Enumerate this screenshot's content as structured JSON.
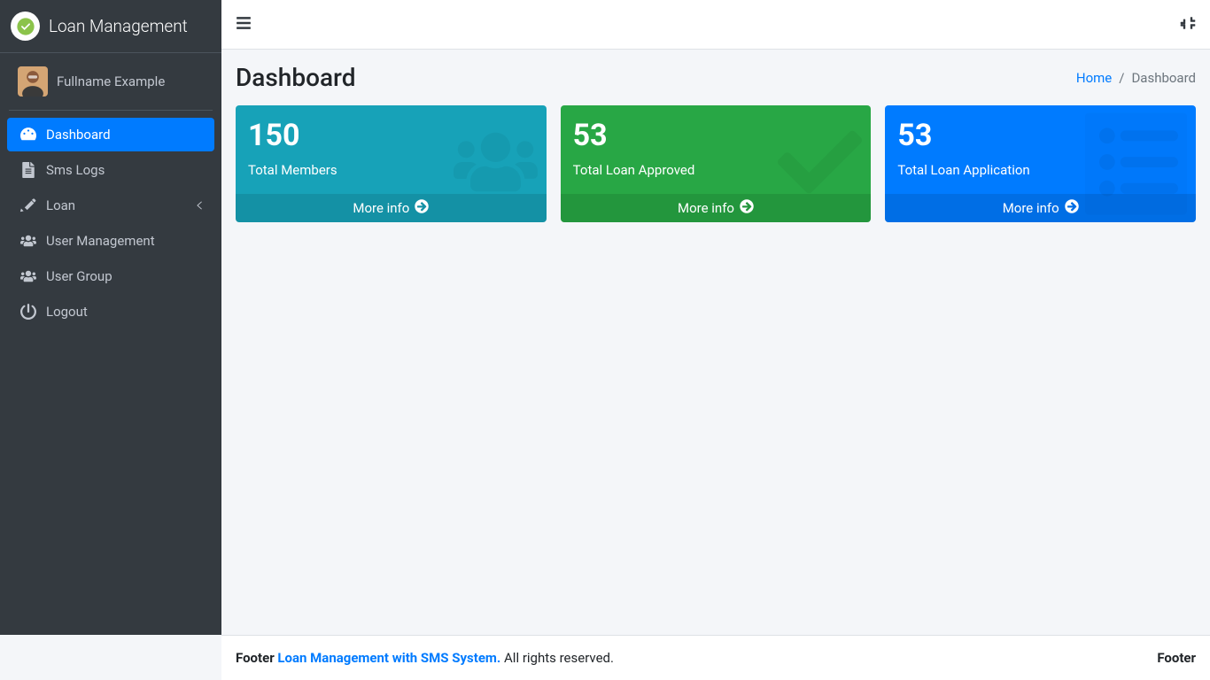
{
  "brand": {
    "title": "Loan Management"
  },
  "user": {
    "fullname": "Fullname Example"
  },
  "sidebar": {
    "items": [
      {
        "label": "Dashboard"
      },
      {
        "label": "Sms Logs"
      },
      {
        "label": "Loan"
      },
      {
        "label": "User Management"
      },
      {
        "label": "User Group"
      },
      {
        "label": "Logout"
      }
    ]
  },
  "header": {
    "title": "Dashboard",
    "breadcrumb": {
      "home": "Home",
      "current": "Dashboard"
    }
  },
  "cards": [
    {
      "value": "150",
      "label": "Total Members",
      "more": "More info"
    },
    {
      "value": "53",
      "label": "Total Loan Approved",
      "more": "More info"
    },
    {
      "value": "53",
      "label": "Total Loan Application",
      "more": "More info"
    }
  ],
  "footer": {
    "left_prefix": "Footer ",
    "link": "Loan Management with SMS System.",
    "rights": " All rights reserved.",
    "right": "Footer"
  }
}
